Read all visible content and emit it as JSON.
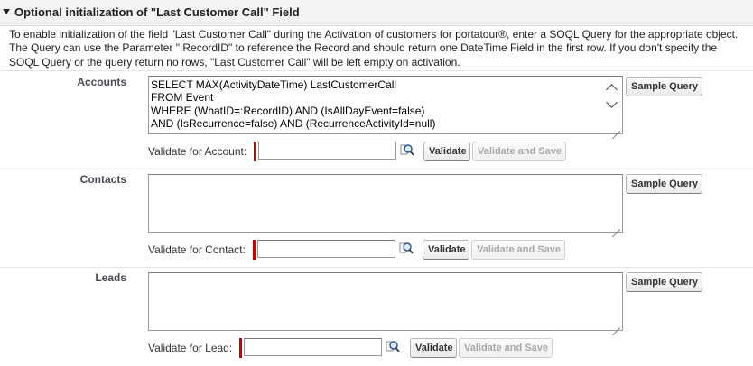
{
  "section": {
    "title": "Optional initialization of \"Last Customer Call\" Field",
    "description": [
      "To enable initialization of the field \"Last Customer Call\" during the Activation of customers for portatour®, enter a SOQL Query for the appropriate object.",
      "The Query can use the Parameter \":RecordID\" to reference the Record and should return one DateTime Field in the first row. If you don't specify the",
      "SOQL Query or the query return no rows, \"Last Customer Call\" will be left empty on activation."
    ]
  },
  "rows": [
    {
      "label": "Accounts",
      "query": "SELECT MAX(ActivityDateTime) LastCustomerCall\nFROM Event\nWHERE (WhatID=:RecordID) AND (IsAllDayEvent=false)\nAND (IsRecurrence=false) AND (RecurrenceActivityId=null)",
      "validate_label": "Validate for Account:",
      "validate_value": "",
      "sample_button": "Sample Query",
      "validate_button": "Validate",
      "validate_save_button": "Validate and Save"
    },
    {
      "label": "Contacts",
      "query": "",
      "validate_label": "Validate for Contact:",
      "validate_value": "",
      "sample_button": "Sample Query",
      "validate_button": "Validate",
      "validate_save_button": "Validate and Save"
    },
    {
      "label": "Leads",
      "query": "",
      "validate_label": "Validate for Lead:",
      "validate_value": "",
      "sample_button": "Sample Query",
      "validate_button": "Validate",
      "validate_save_button": "Validate and Save"
    }
  ],
  "icons": {
    "collapse": "triangle-down-icon",
    "lookup": "magnifier-lookup-icon",
    "scroll_up": "chevron-up-icon",
    "scroll_down": "chevron-down-icon"
  },
  "colors": {
    "required_bar": "#cc0000",
    "header_bg": "#f3f3f3",
    "label_text": "#4a4a56"
  }
}
